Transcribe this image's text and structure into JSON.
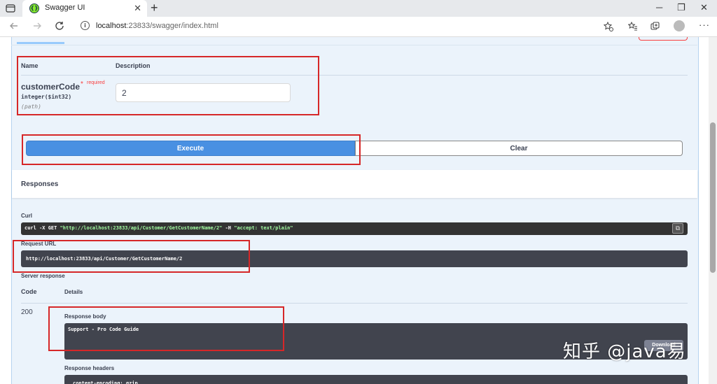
{
  "browser": {
    "tab_title": "Swagger UI",
    "tab_close": "✕",
    "new_tab": "+",
    "favicon_glyph": "{}",
    "url_host": "localhost",
    "url_rest": ":23833/swagger/index.html",
    "window_controls": [
      "─",
      "❐",
      "✕"
    ],
    "toolbar_icons": [
      "star-add-icon",
      "favorites-icon",
      "collections-icon",
      "profile-icon",
      "more-icon"
    ]
  },
  "params": {
    "col_name": "Name",
    "col_description": "Description",
    "name": "customerCode",
    "star": "*",
    "required": "required",
    "type": "integer($int32)",
    "in": "(path)",
    "value": "2"
  },
  "actions": {
    "execute": "Execute",
    "clear": "Clear"
  },
  "responses": {
    "title": "Responses",
    "curl_label": "Curl",
    "curl_cmd_prefix": "curl -X GET ",
    "curl_cmd_url": "\"http://localhost:23833/api/Customer/GetCustomerName/2\"",
    "curl_cmd_mid": " -H  ",
    "curl_cmd_header": "\"accept: text/plain\"",
    "request_url_label": "Request URL",
    "request_url": "http://localhost:23833/api/Customer/GetCustomerName/2",
    "server_response_label": "Server response",
    "col_code": "Code",
    "col_details": "Details",
    "status_code": "200",
    "response_body_label": "Response body",
    "response_body": "Support - Pro Code Guide",
    "download": "Download",
    "response_headers_label": "Response headers",
    "response_headers": "content-encoding: gzip"
  },
  "watermark": "知乎 @java易",
  "colors": {
    "execute_blue": "#4990e2",
    "highlight_red": "#d62728",
    "get_block_bg": "#ebf3fb"
  }
}
